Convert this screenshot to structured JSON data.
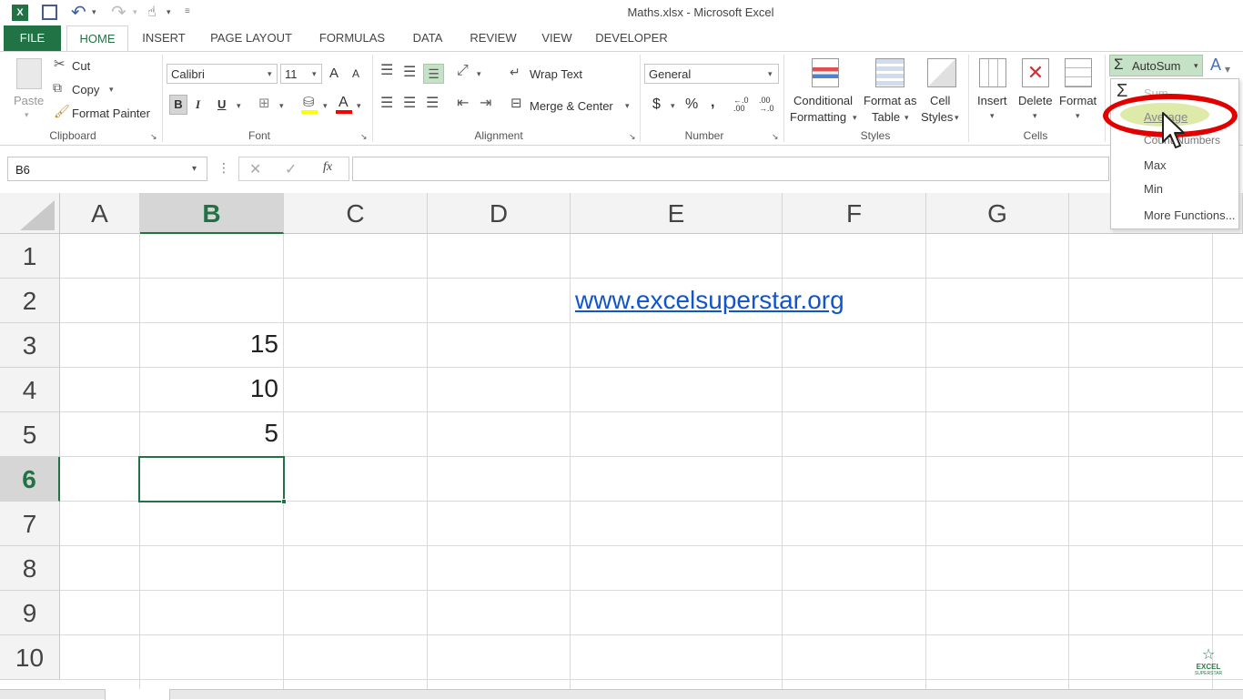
{
  "window": {
    "title": "Maths.xlsx - Microsoft Excel"
  },
  "tabs": [
    "FILE",
    "HOME",
    "INSERT",
    "PAGE LAYOUT",
    "FORMULAS",
    "DATA",
    "REVIEW",
    "VIEW",
    "DEVELOPER"
  ],
  "clipboard": {
    "paste": "Paste",
    "cut": "Cut",
    "copy": "Copy",
    "format_painter": "Format Painter",
    "group": "Clipboard"
  },
  "font": {
    "name": "Calibri",
    "size": "11",
    "bold": "B",
    "italic": "I",
    "underline": "U",
    "grow": "A",
    "shrink": "A",
    "color_a": "A",
    "group": "Font"
  },
  "alignment": {
    "wrap": "Wrap Text",
    "merge": "Merge & Center",
    "group": "Alignment"
  },
  "number": {
    "format": "General",
    "currency": "$",
    "percent": "%",
    "comma": ",",
    "inc_dec": "←.0 .00",
    "dec_dec": ".00 →.0",
    "group": "Number"
  },
  "styles": {
    "conditional_1": "Conditional",
    "conditional_2": "Formatting",
    "format_as_1": "Format as",
    "format_as_2": "Table",
    "cell_1": "Cell",
    "cell_2": "Styles",
    "group": "Styles"
  },
  "cells": {
    "insert": "Insert",
    "delete": "Delete",
    "format": "Format",
    "group": "Cells"
  },
  "editing": {
    "autosum": "AutoSum"
  },
  "autosum_menu": [
    "Sum",
    "Average",
    "Count Numbers",
    "Max",
    "Min",
    "More Functions..."
  ],
  "formula_bar": {
    "name_box": "B6",
    "fx": "fx",
    "value": ""
  },
  "columns": [
    "A",
    "B",
    "C",
    "D",
    "E",
    "F",
    "G"
  ],
  "rows": [
    "1",
    "2",
    "3",
    "4",
    "5",
    "6",
    "7",
    "8",
    "9",
    "10"
  ],
  "cells_data": {
    "B3": "15",
    "B4": "10",
    "B5": "5",
    "E2_link": "www.excelsuperstar.org"
  },
  "watermark": {
    "line1": "EXCEL",
    "line2": "SUPERSTAR"
  },
  "colors": {
    "excel_green": "#217346",
    "link_blue": "#1155cc",
    "highlight_red": "#e00000",
    "selected_header": "#d6d6d6"
  }
}
